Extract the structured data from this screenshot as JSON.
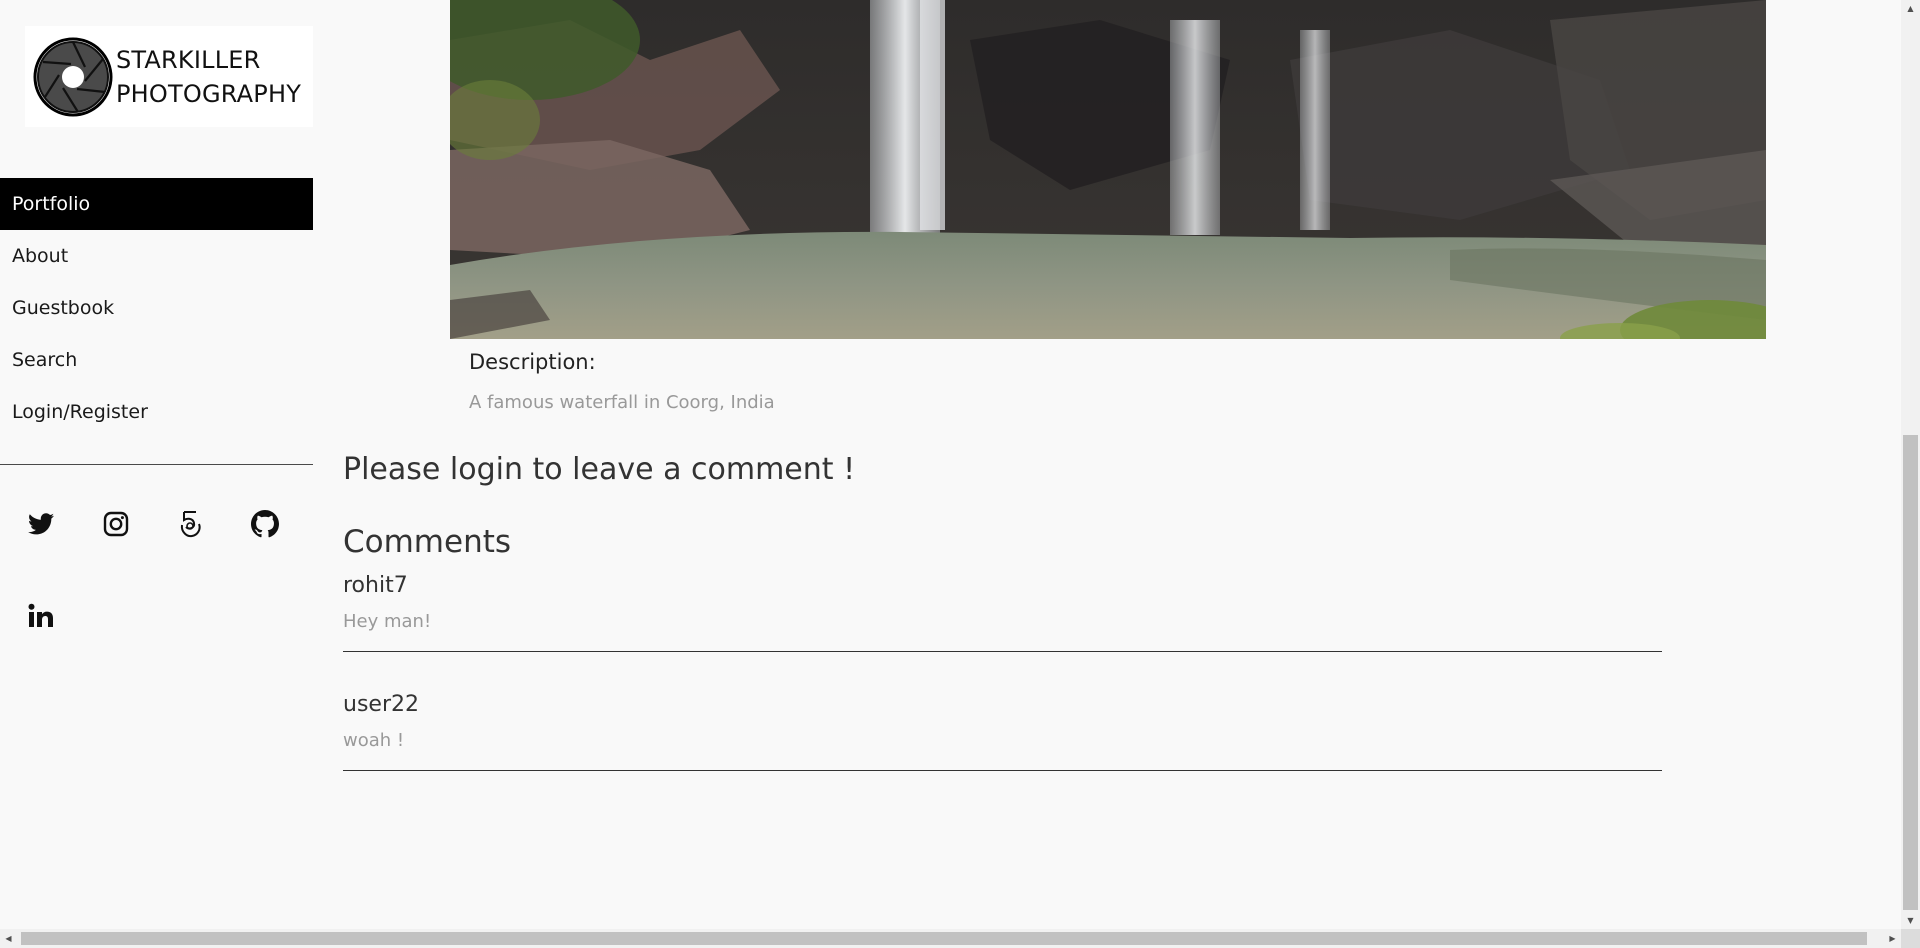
{
  "logo": {
    "line1": "STARKILLER",
    "line2": "PHOTOGRAPHY"
  },
  "nav": {
    "items": [
      {
        "label": "Portfolio",
        "active": true
      },
      {
        "label": "About"
      },
      {
        "label": "Guestbook"
      },
      {
        "label": "Search"
      },
      {
        "label": "Login/Register"
      }
    ]
  },
  "social": {
    "icons": [
      "twitter-icon",
      "instagram-icon",
      "500px-icon",
      "github-icon",
      "linkedin-icon"
    ]
  },
  "photo": {
    "description_label": "Description:",
    "description": "A famous waterfall in Coorg, India"
  },
  "comments_section": {
    "login_prompt": "Please login to leave a comment !",
    "title": "Comments",
    "items": [
      {
        "user": "rohit7",
        "text": "Hey man!"
      },
      {
        "user": "user22",
        "text": "woah !"
      }
    ]
  },
  "scrollbars": {
    "up_arrow": "▲",
    "down_arrow": "▼",
    "left_arrow": "◀",
    "right_arrow": "▶"
  },
  "colors": {
    "nav_active_bg": "#000000",
    "page_bg": "#f9f9f9",
    "muted_text": "#999999"
  }
}
